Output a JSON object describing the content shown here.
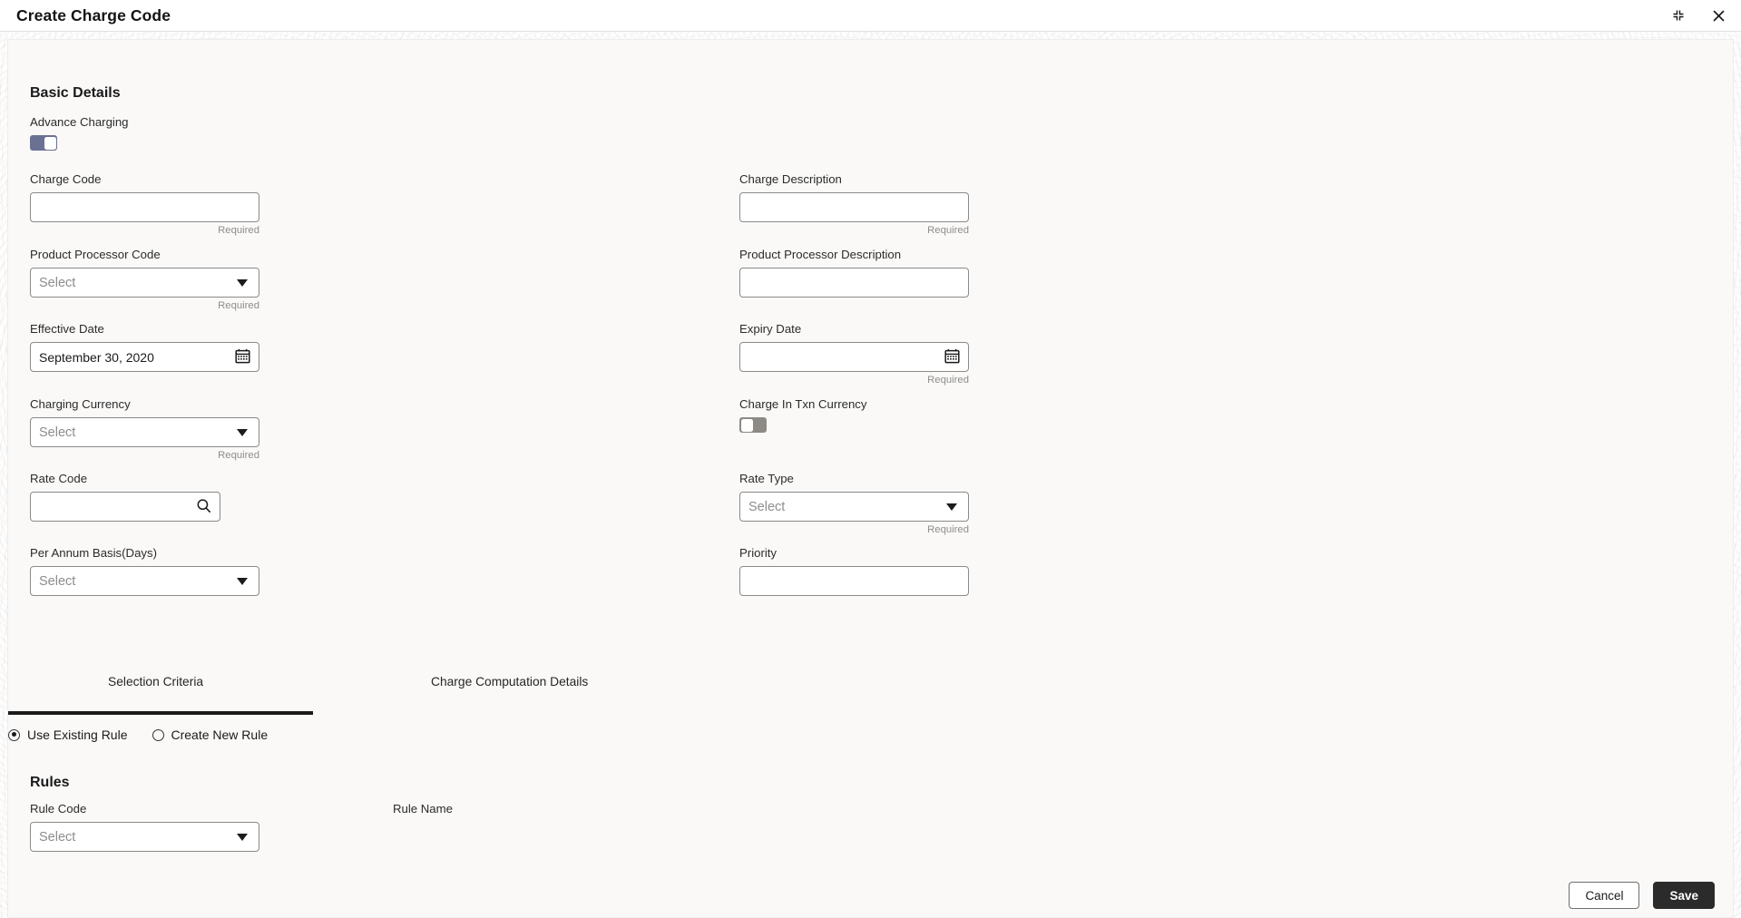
{
  "window": {
    "title": "Create Charge Code",
    "minimize_icon": "collapse-icon",
    "close_icon": "close-icon"
  },
  "basic_details": {
    "heading": "Basic Details",
    "advance_charging": {
      "label": "Advance Charging",
      "state": "on"
    },
    "charge_in_txn_currency": {
      "label": "Charge In Txn Currency",
      "state": "off"
    },
    "fields": {
      "charge_code": {
        "label": "Charge Code",
        "value": "",
        "placeholder": "",
        "helper": "Required"
      },
      "charge_description": {
        "label": "Charge Description",
        "value": "",
        "placeholder": "",
        "helper": "Required"
      },
      "product_processor_code": {
        "label": "Product Processor Code",
        "value": "Select",
        "helper": "Required"
      },
      "product_processor_desc": {
        "label": "Product Processor Description",
        "value": "",
        "placeholder": "",
        "helper": ""
      },
      "effective_date": {
        "label": "Effective Date",
        "value": "September 30, 2020",
        "helper": ""
      },
      "expiry_date": {
        "label": "Expiry Date",
        "value": "",
        "placeholder": "",
        "helper": "Required"
      },
      "charging_currency": {
        "label": "Charging Currency",
        "value": "Select",
        "helper": "Required"
      },
      "rate_code": {
        "label": "Rate Code",
        "value": "",
        "placeholder": "",
        "helper": ""
      },
      "rate_type": {
        "label": "Rate Type",
        "value": "Select",
        "helper": "Required"
      },
      "per_annum_basis": {
        "label": "Per Annum Basis(Days)",
        "value": "Select",
        "helper": ""
      },
      "priority": {
        "label": "Priority",
        "value": "",
        "placeholder": "",
        "helper": ""
      }
    },
    "icons": {
      "calendar": "calendar-icon",
      "search": "search-icon",
      "dropdown": "chevron-down-icon"
    }
  },
  "tabs": [
    {
      "label": "Selection Criteria",
      "active": true
    },
    {
      "label": "Charge Computation Details",
      "active": false
    }
  ],
  "rule_mode": {
    "options": [
      {
        "label": "Use Existing Rule",
        "selected": true
      },
      {
        "label": "Create New Rule",
        "selected": false
      }
    ]
  },
  "rules": {
    "heading": "Rules",
    "rule_code": {
      "label": "Rule Code",
      "value": "Select"
    },
    "rule_name": {
      "label": "Rule Name"
    }
  },
  "footer": {
    "cancel_label": "Cancel",
    "save_label": "Save"
  },
  "colors": {
    "toggle_on": "#6b7193",
    "toggle_off": "#8d8a85",
    "save_bg": "#2b2b2b",
    "panel_bg": "#faf9f8",
    "tab_underline": "#1a1a1a"
  }
}
